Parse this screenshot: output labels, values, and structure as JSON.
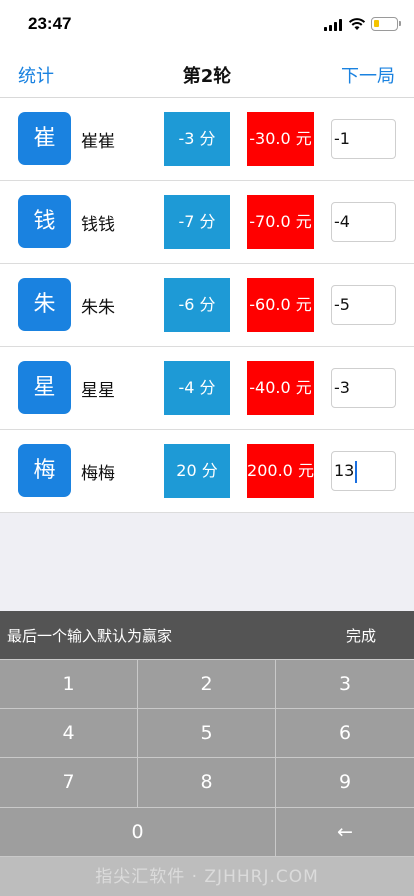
{
  "status_bar": {
    "time": "23:47",
    "battery_color": "#f5c400"
  },
  "nav": {
    "left_label": "统计",
    "title": "第2轮",
    "right_label": "下一局"
  },
  "players": [
    {
      "avatar_char": "崔",
      "name": "崔崔",
      "score": "-3 分",
      "money": "-30.0 元",
      "entry": "-1"
    },
    {
      "avatar_char": "钱",
      "name": "钱钱",
      "score": "-7 分",
      "money": "-70.0 元",
      "entry": "-4"
    },
    {
      "avatar_char": "朱",
      "name": "朱朱",
      "score": "-6 分",
      "money": "-60.0 元",
      "entry": "-5"
    },
    {
      "avatar_char": "星",
      "name": "星星",
      "score": "-4 分",
      "money": "-40.0 元",
      "entry": "-3"
    },
    {
      "avatar_char": "梅",
      "name": "梅梅",
      "score": "20 分",
      "money": "200.0 元",
      "entry": "13"
    }
  ],
  "keyboard": {
    "hint": "最后一个输入默认为赢家",
    "done": "完成",
    "keys": [
      "1",
      "2",
      "3",
      "4",
      "5",
      "6",
      "7",
      "8",
      "9",
      "0",
      "←"
    ]
  },
  "watermark": "指尖汇软件 · ZJHHRJ.COM",
  "colors": {
    "accent_blue": "#1a82e0",
    "score_blue": "#1e9ad6",
    "money_red": "#ff0000"
  }
}
